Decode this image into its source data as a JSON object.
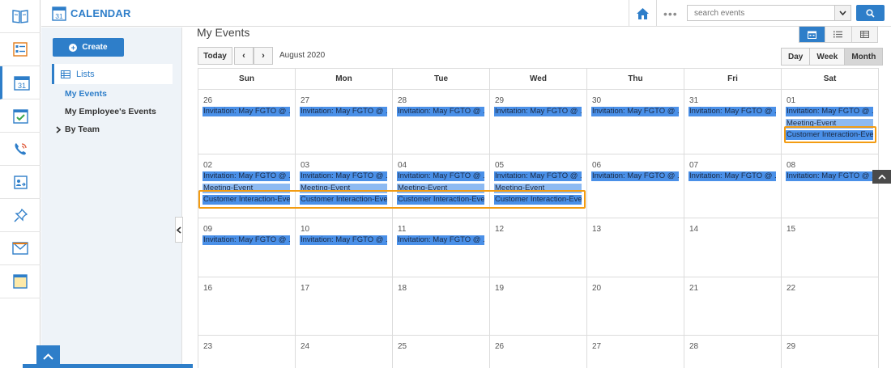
{
  "header": {
    "app_title": "CALENDAR",
    "app_icon_number": "31",
    "dots": "•••",
    "search_placeholder": "search events"
  },
  "rail": {
    "icons": [
      "book-icon",
      "form-icon",
      "calendar-icon",
      "checklist-icon",
      "phone-icon",
      "contact-card-icon",
      "pin-icon",
      "mail-icon",
      "note-icon"
    ],
    "calendar_number": "31"
  },
  "sidebar": {
    "create_label": "Create",
    "lists_label": "Lists",
    "my_events": "My Events",
    "employee_events": "My Employee's Events",
    "by_team": "By Team"
  },
  "main": {
    "page_title": "My Events",
    "today_label": "Today",
    "prev_label": "‹",
    "next_label": "›",
    "month_label": "August 2020",
    "range_day": "Day",
    "range_week": "Week",
    "range_month": "Month"
  },
  "calendar": {
    "days_of_week": [
      "Sun",
      "Mon",
      "Tue",
      "Wed",
      "Thu",
      "Fri",
      "Sat"
    ],
    "weeks": [
      {
        "days": [
          {
            "num": "26",
            "events": [
              {
                "text": "Invitation: May FGTO @ ...",
                "style": "blue"
              }
            ]
          },
          {
            "num": "27",
            "events": [
              {
                "text": "Invitation: May FGTO @ ...",
                "style": "blue"
              }
            ]
          },
          {
            "num": "28",
            "events": [
              {
                "text": "Invitation: May FGTO @ ...",
                "style": "blue"
              }
            ]
          },
          {
            "num": "29",
            "events": [
              {
                "text": "Invitation: May FGTO @ ...",
                "style": "blue"
              }
            ]
          },
          {
            "num": "30",
            "events": [
              {
                "text": "Invitation: May FGTO @ ...",
                "style": "blue"
              }
            ]
          },
          {
            "num": "31",
            "events": [
              {
                "text": "Invitation: May FGTO @ ...",
                "style": "blue"
              }
            ]
          },
          {
            "num": "01",
            "events": [
              {
                "text": "Invitation: May FGTO @ ...",
                "style": "blue"
              },
              {
                "text": "Meeting-Event",
                "style": "lblue"
              },
              {
                "text": "Customer Interaction-Event",
                "style": "blue"
              }
            ]
          }
        ]
      },
      {
        "days": [
          {
            "num": "02",
            "events": [
              {
                "text": "Invitation: May FGTO @ ...",
                "style": "blue"
              },
              {
                "text": "Meeting-Event",
                "style": "lblue"
              },
              {
                "text": "Customer Interaction-Event",
                "style": "blue"
              }
            ]
          },
          {
            "num": "03",
            "events": [
              {
                "text": "Invitation: May FGTO @ ...",
                "style": "blue"
              },
              {
                "text": "Meeting-Event",
                "style": "lblue"
              },
              {
                "text": "Customer Interaction-Event",
                "style": "blue"
              }
            ]
          },
          {
            "num": "04",
            "events": [
              {
                "text": "Invitation: May FGTO @ ...",
                "style": "blue"
              },
              {
                "text": "Meeting-Event",
                "style": "lblue"
              },
              {
                "text": "Customer Interaction-Event",
                "style": "blue"
              }
            ]
          },
          {
            "num": "05",
            "events": [
              {
                "text": "Invitation: May FGTO @ ...",
                "style": "blue"
              },
              {
                "text": "Meeting-Event",
                "style": "lblue"
              },
              {
                "text": "Customer Interaction-Event",
                "style": "blue"
              }
            ]
          },
          {
            "num": "06",
            "events": [
              {
                "text": "Invitation: May FGTO @ ...",
                "style": "blue"
              }
            ]
          },
          {
            "num": "07",
            "events": [
              {
                "text": "Invitation: May FGTO @ ...",
                "style": "blue"
              }
            ]
          },
          {
            "num": "08",
            "events": [
              {
                "text": "Invitation: May FGTO @ ...",
                "style": "blue"
              }
            ]
          }
        ]
      },
      {
        "days": [
          {
            "num": "09",
            "events": [
              {
                "text": "Invitation: May FGTO @ ...",
                "style": "blue"
              }
            ]
          },
          {
            "num": "10",
            "events": [
              {
                "text": "Invitation: May FGTO @ ...",
                "style": "blue"
              }
            ]
          },
          {
            "num": "11",
            "events": [
              {
                "text": "Invitation: May FGTO @ ...",
                "style": "blue"
              }
            ]
          },
          {
            "num": "12",
            "events": []
          },
          {
            "num": "13",
            "events": []
          },
          {
            "num": "14",
            "events": []
          },
          {
            "num": "15",
            "events": []
          }
        ]
      },
      {
        "days": [
          {
            "num": "16",
            "events": []
          },
          {
            "num": "17",
            "events": []
          },
          {
            "num": "18",
            "events": []
          },
          {
            "num": "19",
            "events": []
          },
          {
            "num": "20",
            "events": []
          },
          {
            "num": "21",
            "events": []
          },
          {
            "num": "22",
            "events": []
          }
        ]
      },
      {
        "days": [
          {
            "num": "23",
            "events": []
          },
          {
            "num": "24",
            "events": []
          },
          {
            "num": "25",
            "events": []
          },
          {
            "num": "26",
            "events": []
          },
          {
            "num": "27",
            "events": []
          },
          {
            "num": "28",
            "events": []
          },
          {
            "num": "29",
            "events": []
          }
        ]
      }
    ]
  },
  "colors": {
    "accent": "#2e7ec9",
    "event_blue": "#4a90e8",
    "event_light_blue": "#8dbaf2",
    "highlight": "#f39c12"
  }
}
